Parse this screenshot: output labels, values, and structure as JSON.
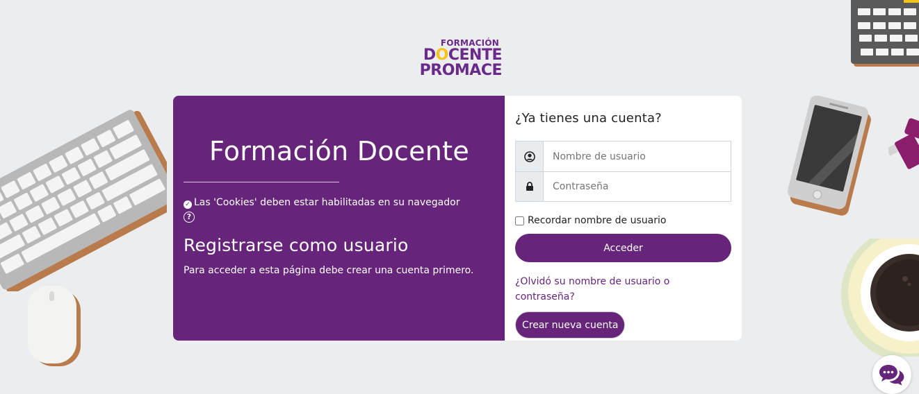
{
  "logo": {
    "line1": "FORMACIÓN",
    "line2_pre": "D",
    "line2_bulb": "O",
    "line2_post": "CENTE",
    "line3": "PROMACE"
  },
  "left_panel": {
    "site_title": "Formación Docente",
    "cookies_notice": "Las 'Cookies' deben estar habilitadas en su navegador",
    "signup_heading": "Registrarse como usuario",
    "signup_text": "Para acceder a esta página debe crear una cuenta primero."
  },
  "login": {
    "heading": "¿Ya tienes una cuenta?",
    "username_placeholder": "Nombre de usuario",
    "password_placeholder": "Contraseña",
    "remember_label": "Recordar nombre de usuario",
    "submit_label": "Acceder",
    "forgot_link": "¿Olvidó su nombre de usuario o contraseña?",
    "create_account_label": "Crear nueva cuenta"
  },
  "icons": {
    "user": "user-circle-icon",
    "lock": "lock-icon",
    "check": "check-circle-icon",
    "help": "question-circle-icon",
    "chat": "chat-bubbles-icon"
  },
  "colors": {
    "brand_purple": "#66247a",
    "background": "#ecedef",
    "bulb_yellow": "#f2c419"
  }
}
